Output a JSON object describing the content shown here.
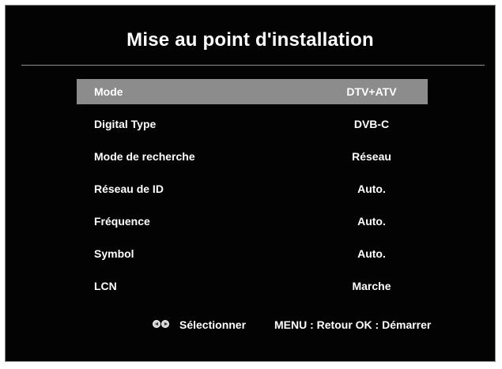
{
  "title": "Mise au point d'installation",
  "menu": {
    "items": [
      {
        "label": "Mode",
        "value": "DTV+ATV"
      },
      {
        "label": "Digital Type",
        "value": "DVB-C"
      },
      {
        "label": "Mode de recherche",
        "value": "Réseau"
      },
      {
        "label": "Réseau de ID",
        "value": "Auto."
      },
      {
        "label": "Fréquence",
        "value": "Auto."
      },
      {
        "label": "Symbol",
        "value": "Auto."
      },
      {
        "label": "LCN",
        "value": "Marche"
      }
    ],
    "selected_index": 0
  },
  "footer": {
    "select_label": "Sélectionner",
    "menu_hint": "MENU : Retour OK : Démarrer",
    "icon": "left-right-arrow-buttons-icon"
  },
  "colors": {
    "background": "#030303",
    "highlight": "#8c8c8c",
    "text": "#ffffff",
    "divider": "#8f8f8f"
  }
}
